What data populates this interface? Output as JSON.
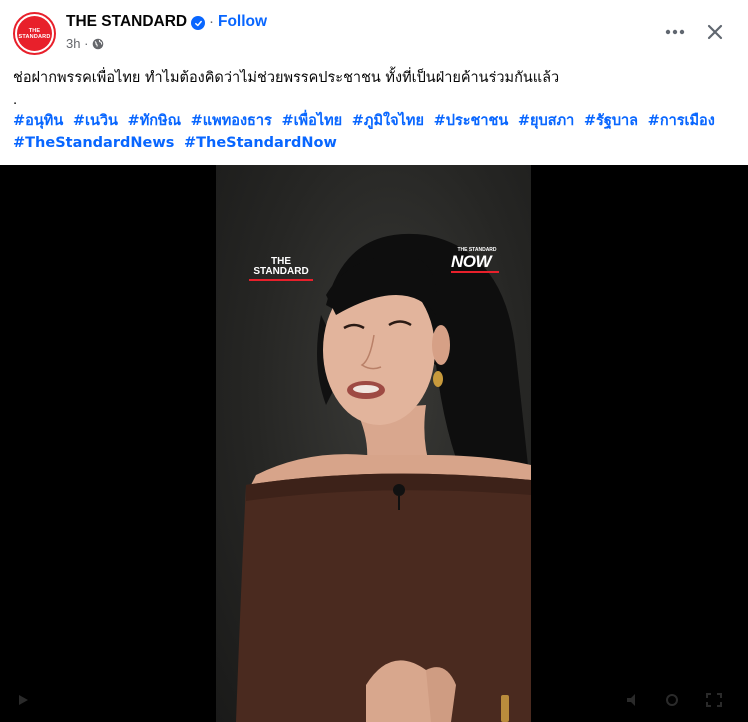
{
  "header": {
    "avatar_text": "THE STANDARD",
    "page_name": "THE STANDARD",
    "separator": "·",
    "follow_label": "Follow",
    "time": "3h ·",
    "icons": {
      "verified": "verified-badge-icon",
      "privacy": "globe-icon",
      "more": "more-horiz-icon",
      "close": "close-icon"
    }
  },
  "post": {
    "caption": "ช่อฝากพรรคเพื่อไทย ทำไมต้องคิดว่าไม่ช่วยพรรคประชาชน ทั้งที่เป็นฝ่ายค้านร่วมกันแล้ว",
    "dot": ".",
    "hashtags": [
      "#อนุทิน",
      "#เนวิน",
      "#ทักษิณ",
      "#แพทองธาร",
      "#เพื่อไทย",
      "#ภูมิใจไทย",
      "#ประชาชน",
      "#ยุบสภา",
      "#รัฐบาล",
      "#การเมือง",
      "#TheStandardNews",
      "#TheStandardNow"
    ]
  },
  "video": {
    "watermark_left_line1": "THE",
    "watermark_left_line2": "STANDARD",
    "watermark_right_small": "THE STANDARD",
    "watermark_right_main": "NOW"
  },
  "colors": {
    "accent": "#0866ff",
    "brand_red": "#e8202b",
    "text": "#050505",
    "muted": "#65676b"
  }
}
